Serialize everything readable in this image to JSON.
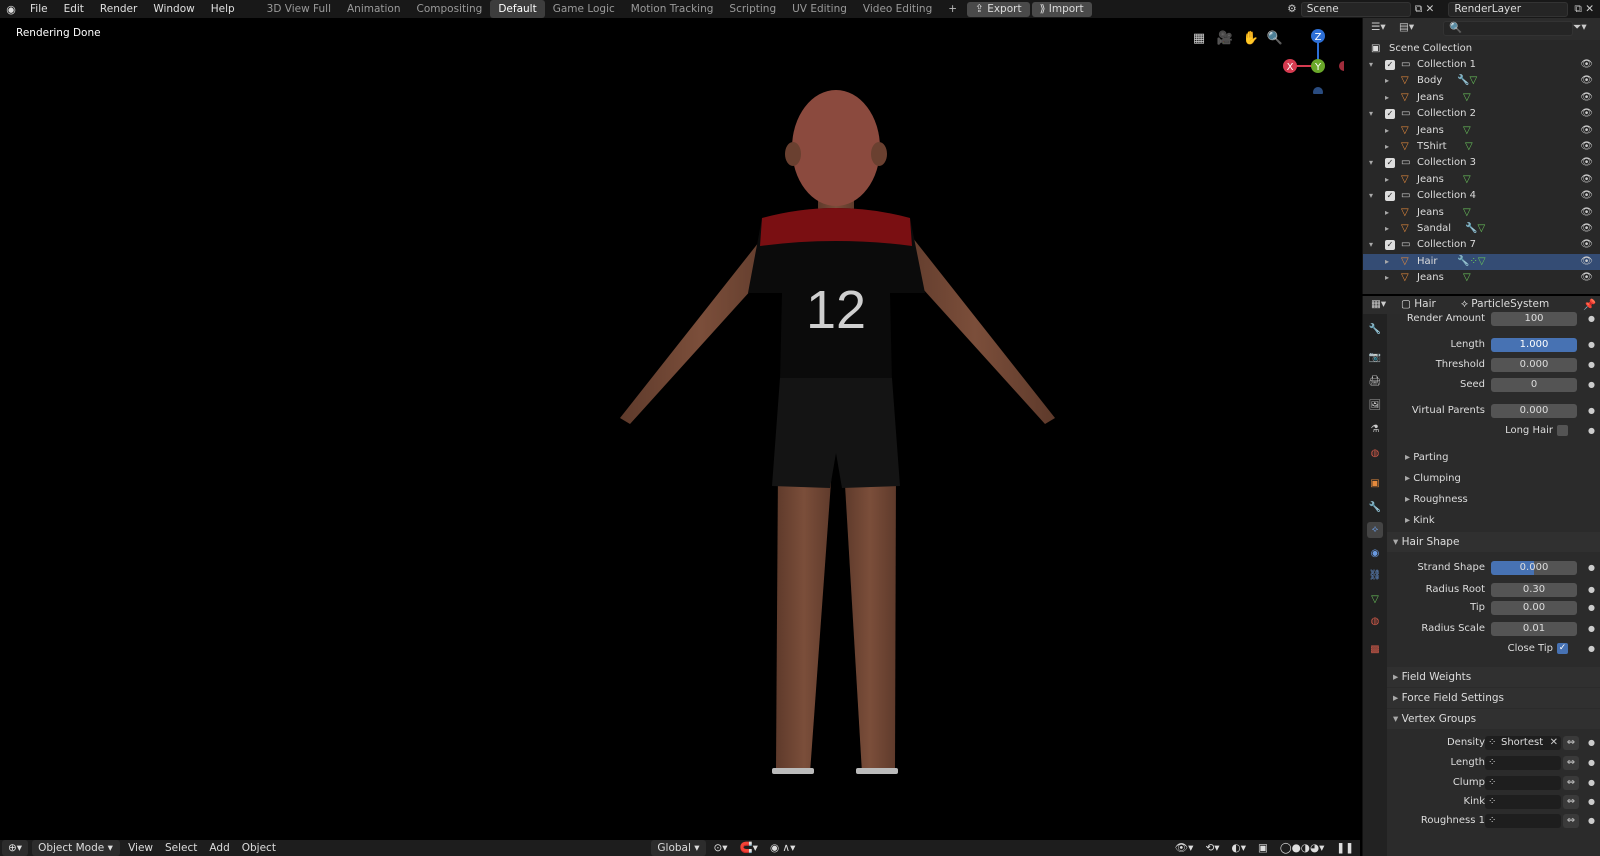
{
  "topbar": {
    "menus": [
      "File",
      "Edit",
      "Render",
      "Window",
      "Help"
    ],
    "workspaces": [
      "3D View Full",
      "Animation",
      "Compositing",
      "Default",
      "Game Logic",
      "Motion Tracking",
      "Scripting",
      "UV Editing",
      "Video Editing"
    ],
    "active_workspace": "Default",
    "add_tab": "+",
    "export_label": "Export",
    "import_label": "Import",
    "scene": "Scene",
    "render_layer": "RenderLayer"
  },
  "viewport": {
    "status": "Rendering Done",
    "jersey_number": "12",
    "gizmo": {
      "z": "Z",
      "y": "Y",
      "x": "X"
    }
  },
  "bottombar": {
    "mode": "Object Mode",
    "menus": [
      "View",
      "Select",
      "Add",
      "Object"
    ],
    "orientation": "Global"
  },
  "outliner": {
    "root": "Scene Collection",
    "rows": [
      {
        "label": "Collection 1",
        "type": "collection"
      },
      {
        "label": "Body",
        "type": "object"
      },
      {
        "label": "Jeans",
        "type": "object"
      },
      {
        "label": "Collection 2",
        "type": "collection"
      },
      {
        "label": "Jeans",
        "type": "object"
      },
      {
        "label": "TShirt",
        "type": "object"
      },
      {
        "label": "Collection 3",
        "type": "collection"
      },
      {
        "label": "Jeans",
        "type": "object"
      },
      {
        "label": "Collection 4",
        "type": "collection"
      },
      {
        "label": "Jeans",
        "type": "object"
      },
      {
        "label": "Sandal",
        "type": "object"
      },
      {
        "label": "Collection 7",
        "type": "collection"
      },
      {
        "label": "Hair",
        "type": "object",
        "selected": true
      },
      {
        "label": "Jeans",
        "type": "object"
      }
    ]
  },
  "properties": {
    "object": "Hair",
    "particle_system": "ParticleSystem",
    "render_amount": {
      "label": "Render Amount",
      "value": "100"
    },
    "length": {
      "label": "Length",
      "value": "1.000"
    },
    "threshold": {
      "label": "Threshold",
      "value": "0.000"
    },
    "seed": {
      "label": "Seed",
      "value": "0"
    },
    "virtual_parents": {
      "label": "Virtual Parents",
      "value": "0.000"
    },
    "long_hair": {
      "label": "Long Hair",
      "checked": false
    },
    "subpanels": [
      "Parting",
      "Clumping",
      "Roughness",
      "Kink"
    ],
    "hair_shape": {
      "title": "Hair Shape",
      "strand_shape": {
        "label": "Strand Shape",
        "value": "0.000"
      },
      "radius_root": {
        "label": "Radius Root",
        "value": "0.30"
      },
      "tip": {
        "label": "Tip",
        "value": "0.00"
      },
      "radius_scale": {
        "label": "Radius Scale",
        "value": "0.01"
      },
      "close_tip": {
        "label": "Close Tip",
        "checked": true
      }
    },
    "field_weights": "Field Weights",
    "force_field_settings": "Force Field Settings",
    "vertex_groups": {
      "title": "Vertex Groups",
      "density": {
        "label": "Density",
        "value": "Shortest"
      },
      "length": {
        "label": "Length",
        "value": ""
      },
      "clump": {
        "label": "Clump",
        "value": ""
      },
      "kink": {
        "label": "Kink",
        "value": ""
      },
      "roughness1": {
        "label": "Roughness 1",
        "value": ""
      }
    }
  },
  "colors": {
    "accent_blue": "#4772b3",
    "selected_row": "#344c74",
    "object_orange": "#e58a3c",
    "mesh_green": "#6ac45b"
  }
}
